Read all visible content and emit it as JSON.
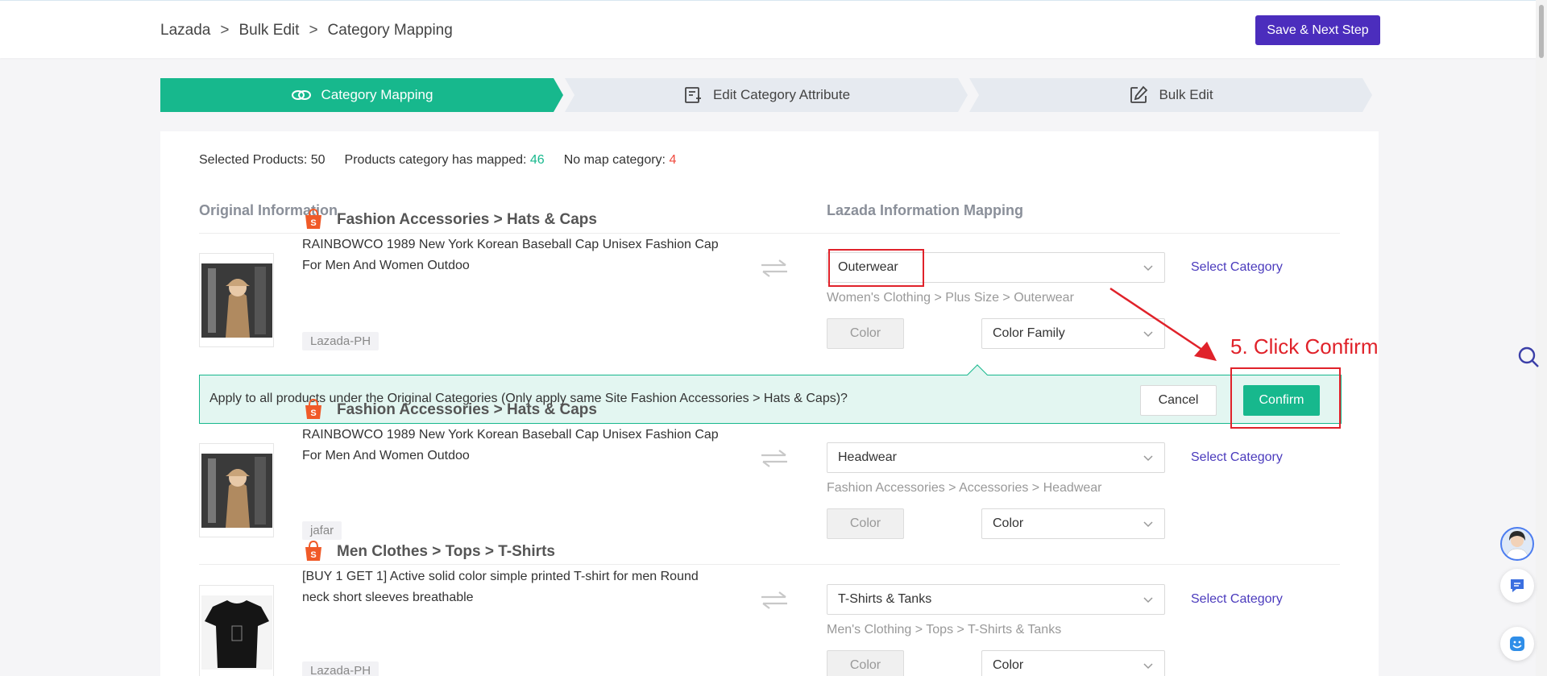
{
  "breadcrumb": [
    "Lazada",
    "Bulk Edit",
    "Category Mapping"
  ],
  "breadcrumb_sep": ">",
  "save_button": "Save & Next Step",
  "steps": [
    {
      "label": "Category Mapping",
      "icon": "link-icon",
      "active": true
    },
    {
      "label": "Edit Category Attribute",
      "icon": "edit-doc-icon",
      "active": false
    },
    {
      "label": "Bulk Edit",
      "icon": "pencil-square-icon",
      "active": false
    }
  ],
  "summary": {
    "selected_label": "Selected Products: 50",
    "mapped_label": "Products category has mapped: ",
    "mapped_count": "46",
    "nomap_label": "No map category: ",
    "nomap_count": "4"
  },
  "columns": {
    "left": "Original Information",
    "right": "Lazada Information Mapping"
  },
  "products": [
    {
      "category": "Fashion Accessories > Hats & Caps",
      "name": "RAINBOWCO 1989 New York Korean Baseball Cap Unisex Fashion Cap For Men And Women Outdoo",
      "site": "Lazada-PH",
      "mapped_category": "Outerwear",
      "mapped_path": "Women's Clothing > Plus Size > Outerwear",
      "color_button": "Color",
      "color_select": "Color Family",
      "select_category": "Select Category"
    },
    {
      "category": "Fashion Accessories > Hats & Caps",
      "name": "RAINBOWCO 1989 New York Korean Baseball Cap Unisex Fashion Cap For Men And Women Outdoo",
      "site": "jafar",
      "mapped_category": "Headwear",
      "mapped_path": "Fashion Accessories > Accessories > Headwear",
      "color_button": "Color",
      "color_select": "Color",
      "select_category": "Select Category"
    },
    {
      "category": "Men Clothes > Tops > T-Shirts",
      "name": "[BUY 1 GET 1] Active solid color simple printed T-shirt for men Round neck short sleeves breathable",
      "site": "Lazada-PH",
      "mapped_category": "T-Shirts & Tanks",
      "mapped_path": "Men's Clothing > Tops > T-Shirts & Tanks",
      "color_button": "Color",
      "color_select": "Color",
      "select_category": "Select Category"
    }
  ],
  "apply_bar": {
    "text": "Apply to all products under the Original Categories (Only apply same Site Fashion Accessories > Hats & Caps)?",
    "cancel": "Cancel",
    "confirm": "Confirm"
  },
  "annotation": "5. Click Confirm",
  "colors": {
    "primary": "#4b2dbd",
    "accent": "#17b88d",
    "annotation": "#e0222a",
    "link": "#4b3bbd"
  }
}
